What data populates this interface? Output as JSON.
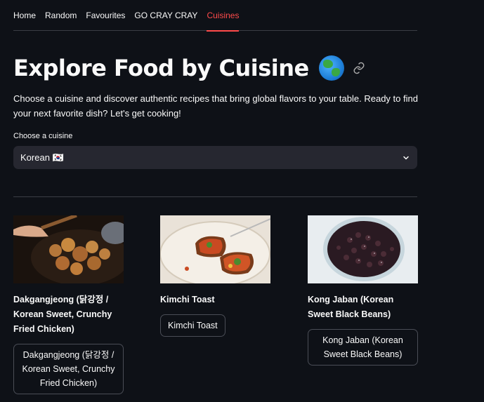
{
  "nav": {
    "items": [
      {
        "label": "Home",
        "active": false
      },
      {
        "label": "Random",
        "active": false
      },
      {
        "label": "Favourites",
        "active": false
      },
      {
        "label": "GO CRAY CRAY",
        "active": false
      },
      {
        "label": "Cuisines",
        "active": true
      }
    ]
  },
  "header": {
    "title": "Explore Food by Cuisine",
    "emoji_icon": "globe-asia-icon",
    "link_icon": "link-icon"
  },
  "intro": "Choose a cuisine and discover authentic recipes that bring global flavors to your table. Ready to find your next favorite dish? Let's get cooking!",
  "cuisine_select": {
    "label": "Choose a cuisine",
    "value": "Korean 🇰🇷"
  },
  "recipes": [
    {
      "title": "Dakgangjeong (닭강정 / Korean Sweet, Crunchy Fried Chicken)",
      "button": "Dakgangjeong (닭강정 / Korean Sweet, Crunchy Fried Chicken)"
    },
    {
      "title": "Kimchi Toast",
      "button": "Kimchi Toast"
    },
    {
      "title": "Kong Jaban (Korean Sweet Black Beans)",
      "button": "Kong Jaban (Korean Sweet Black Beans)"
    }
  ],
  "colors": {
    "background": "#0e1117",
    "accent": "#ff4b4b",
    "select_bg": "#262730"
  }
}
